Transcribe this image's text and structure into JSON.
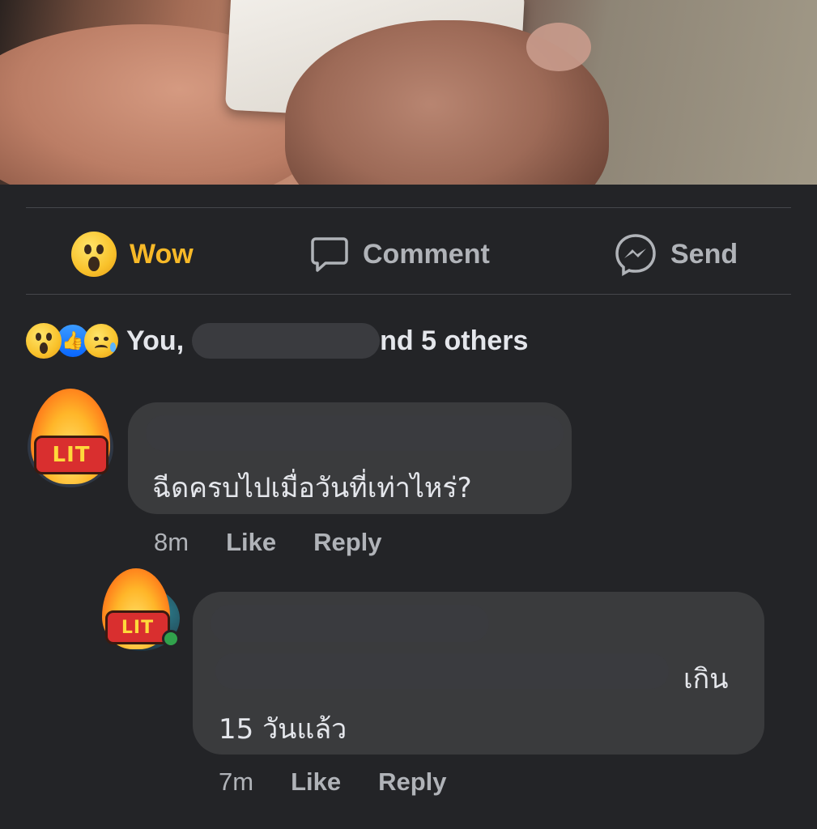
{
  "actions": {
    "wow_label": "Wow",
    "comment_label": "Comment",
    "send_label": "Send"
  },
  "reactions": {
    "icons": [
      "wow-emoji",
      "like-icon",
      "sad-emoji"
    ],
    "prefix": "You,",
    "suffix": "nd 5 others"
  },
  "comments": [
    {
      "text": "ฉีดครบไปเมื่อวันที่เท่าไหร่?",
      "time": "8m",
      "like_label": "Like",
      "reply_label": "Reply",
      "avatar_badge": "LIT"
    },
    {
      "text_end": "เกิน",
      "text_line2": "15 วันแล้ว",
      "time": "7m",
      "like_label": "Like",
      "reply_label": "Reply",
      "avatar_badge": "LIT"
    }
  ],
  "colors": {
    "background": "#232427",
    "bubble": "#3a3b3d",
    "wow_accent": "#f7b928",
    "secondary_text": "#b0b3b8",
    "online": "#31a24c"
  }
}
